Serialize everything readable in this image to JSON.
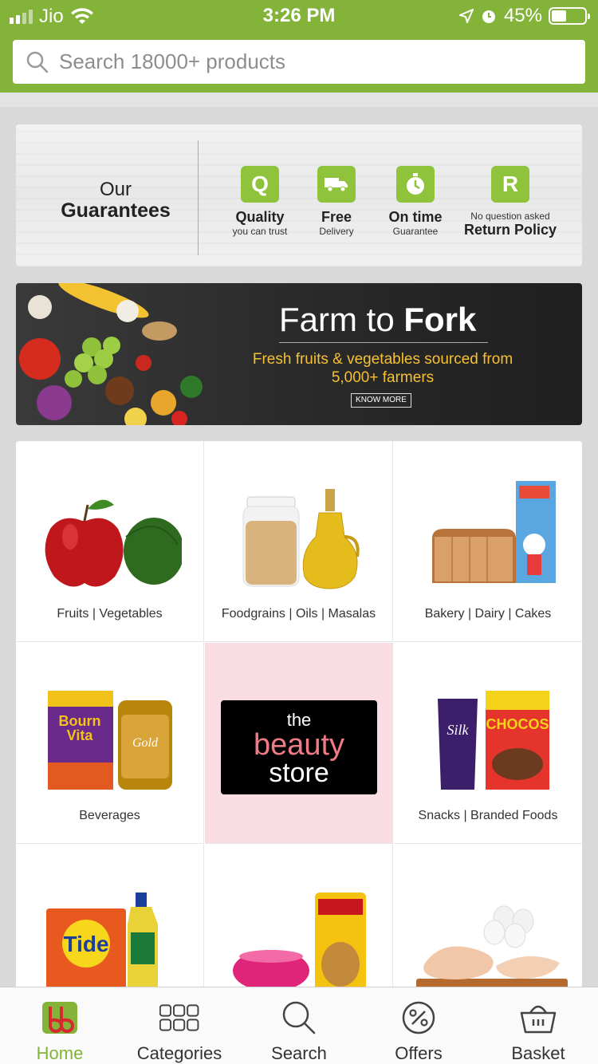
{
  "status_bar": {
    "carrier": "Jio",
    "time": "3:26 PM",
    "battery_percent": "45%",
    "battery_level": 0.45,
    "icons": [
      "signal-icon",
      "wifi-icon",
      "location-arrow-icon",
      "alarm-clock-icon",
      "battery-icon"
    ]
  },
  "search": {
    "placeholder": "Search 18000+ products"
  },
  "guarantees": {
    "title_line1": "Our",
    "title_line2": "Guarantees",
    "items": [
      {
        "big": "Quality",
        "small": "you can trust",
        "icon": "quality-icon",
        "glyph": "Q"
      },
      {
        "big": "Free",
        "small": "Delivery",
        "icon": "delivery-truck-icon",
        "glyph": ""
      },
      {
        "big": "On time",
        "small": "Guarantee",
        "icon": "stopwatch-icon",
        "glyph": ""
      },
      {
        "small_top": "No question asked",
        "big": "Return Policy",
        "icon": "return-policy-icon",
        "glyph": "R"
      }
    ]
  },
  "banner": {
    "title_light": "Farm to ",
    "title_bold": "Fork",
    "subtitle_line1": "Fresh fruits & vegetables sourced from",
    "subtitle_line2": "5,000+ farmers",
    "button": "KNOW MORE"
  },
  "categories": [
    {
      "label": "Fruits | Vegetables"
    },
    {
      "label": "Foodgrains | Oils | Masalas"
    },
    {
      "label": "Bakery | Dairy | Cakes"
    },
    {
      "label": "Beverages"
    },
    {
      "label": "",
      "beauty": {
        "line1": "the",
        "line2": "beauty",
        "line3": "store"
      }
    },
    {
      "label": "Snacks | Branded Foods"
    },
    {
      "label": ""
    },
    {
      "label": ""
    },
    {
      "label": ""
    }
  ],
  "tabbar": {
    "items": [
      {
        "label": "Home",
        "icon": "bigbasket-logo-icon",
        "active": true
      },
      {
        "label": "Categories",
        "icon": "grid-icon"
      },
      {
        "label": "Search",
        "icon": "search-icon"
      },
      {
        "label": "Offers",
        "icon": "percent-badge-icon"
      },
      {
        "label": "Basket",
        "icon": "basket-icon"
      }
    ]
  },
  "colors": {
    "brand_green": "#84b33a",
    "icon_green": "#8fc33c",
    "accent_yellow": "#f6c033",
    "beauty_pink": "#f07b86"
  }
}
